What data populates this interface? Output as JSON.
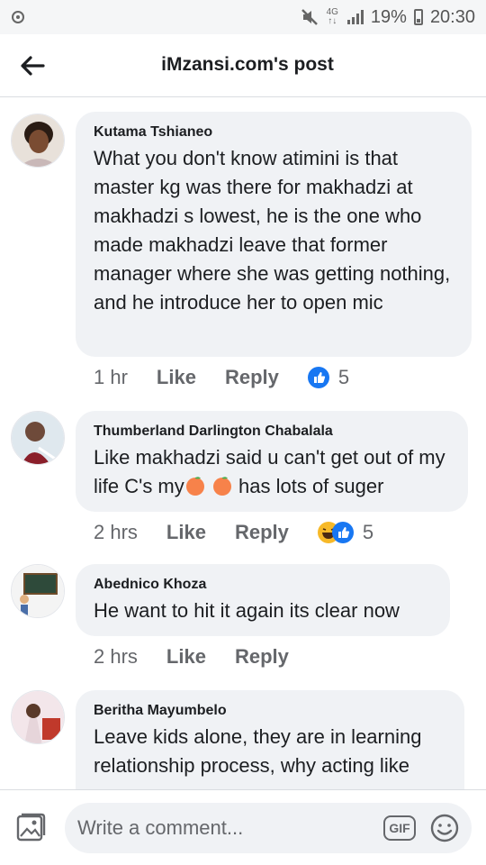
{
  "status_bar": {
    "network": "4G",
    "battery": "19%",
    "time": "20:30"
  },
  "header": {
    "title": "iMzansi.com's post"
  },
  "comments": [
    {
      "author": "Kutama Tshianeo",
      "text": "What you don't know atimini is that master kg was there for makhadzi at makhadzi s lowest, he is the one who made makhadzi leave that former manager where she was getting nothing, and he introduce her to open mic",
      "time": "1 hr",
      "like": "Like",
      "reply": "Reply",
      "reaction_count": "5"
    },
    {
      "author": "Thumberland Darlington Chabalala",
      "text_parts": [
        "Like makhadzi said u can't get out of my life C's my",
        "has lots of suger"
      ],
      "time": "2 hrs",
      "like": "Like",
      "reply": "Reply",
      "reaction_count": "5"
    },
    {
      "author": "Abednico Khoza",
      "text": "He want to hit it again its clear now",
      "time": "2 hrs",
      "like": "Like",
      "reply": "Reply"
    },
    {
      "author": "Beritha Mayumbelo",
      "text": "Leave kids alone, they are in learning relationship process, why acting like"
    }
  ],
  "composer": {
    "placeholder": "Write a comment...",
    "gif_label": "GIF"
  },
  "colors": {
    "like_blue": "#1877f2",
    "bubble_bg": "#f0f2f5",
    "muted_text": "#65676b"
  }
}
